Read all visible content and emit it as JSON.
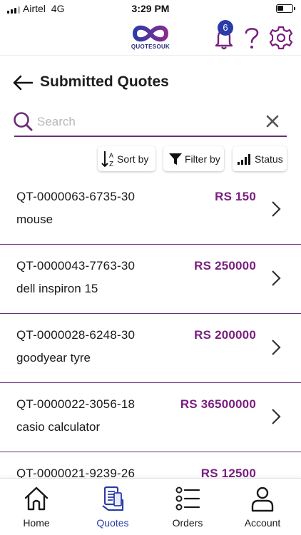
{
  "status_bar": {
    "carrier": "Airtel",
    "network": "4G",
    "time": "3:29 PM"
  },
  "header": {
    "logo_text": "QUOTESOUK",
    "notification_count": "6"
  },
  "page": {
    "title": "Submitted Quotes"
  },
  "search": {
    "placeholder": "Search",
    "value": ""
  },
  "toolbar": {
    "sort_label": "Sort by",
    "filter_label": "Filter by",
    "status_label": "Status"
  },
  "quotes": [
    {
      "id": "QT-0000063-6735-30",
      "name": "mouse",
      "price": "RS 150"
    },
    {
      "id": "QT-0000043-7763-30",
      "name": "dell inspiron 15",
      "price": "RS 250000"
    },
    {
      "id": "QT-0000028-6248-30",
      "name": "goodyear tyre",
      "price": "RS 200000"
    },
    {
      "id": "QT-0000022-3056-18",
      "name": "casio calculator",
      "price": "RS 36500000"
    },
    {
      "id": "QT-0000021-9239-26",
      "name": "",
      "price": "RS 12500"
    }
  ],
  "nav": {
    "items": [
      {
        "label": "Home",
        "icon": "home-icon"
      },
      {
        "label": "Quotes",
        "icon": "quotes-icon"
      },
      {
        "label": "Orders",
        "icon": "orders-icon"
      },
      {
        "label": "Account",
        "icon": "account-icon"
      }
    ],
    "active": "Quotes"
  },
  "colors": {
    "accent": "#7a1f7f",
    "active": "#2b3ca8",
    "divider": "#6b2d78"
  }
}
